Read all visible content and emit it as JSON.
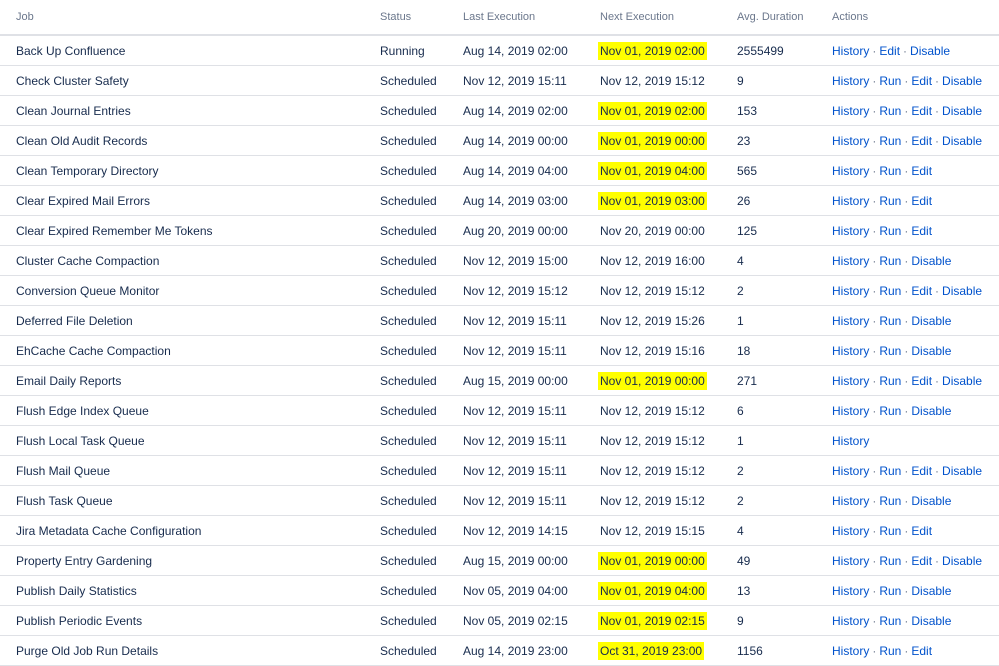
{
  "headers": {
    "job": "Job",
    "status": "Status",
    "last": "Last Execution",
    "next": "Next Execution",
    "avg": "Avg. Duration",
    "actions": "Actions"
  },
  "highlight_color": "#ffff00",
  "link_color": "#0052cc",
  "rows": [
    {
      "job": "Back Up Confluence",
      "status": "Running",
      "last": "Aug 14, 2019 02:00",
      "next": "Nov 01, 2019 02:00",
      "highlight": true,
      "avg": "2555499",
      "actions": [
        "History",
        "Edit",
        "Disable"
      ]
    },
    {
      "job": "Check Cluster Safety",
      "status": "Scheduled",
      "last": "Nov 12, 2019 15:11",
      "next": "Nov 12, 2019 15:12",
      "highlight": false,
      "avg": "9",
      "actions": [
        "History",
        "Run",
        "Edit",
        "Disable"
      ]
    },
    {
      "job": "Clean Journal Entries",
      "status": "Scheduled",
      "last": "Aug 14, 2019 02:00",
      "next": "Nov 01, 2019 02:00",
      "highlight": true,
      "avg": "153",
      "actions": [
        "History",
        "Run",
        "Edit",
        "Disable"
      ]
    },
    {
      "job": "Clean Old Audit Records",
      "status": "Scheduled",
      "last": "Aug 14, 2019 00:00",
      "next": "Nov 01, 2019 00:00",
      "highlight": true,
      "avg": "23",
      "actions": [
        "History",
        "Run",
        "Edit",
        "Disable"
      ]
    },
    {
      "job": "Clean Temporary Directory",
      "status": "Scheduled",
      "last": "Aug 14, 2019 04:00",
      "next": "Nov 01, 2019 04:00",
      "highlight": true,
      "avg": "565",
      "actions": [
        "History",
        "Run",
        "Edit"
      ]
    },
    {
      "job": "Clear Expired Mail Errors",
      "status": "Scheduled",
      "last": "Aug 14, 2019 03:00",
      "next": "Nov 01, 2019 03:00",
      "highlight": true,
      "avg": "26",
      "actions": [
        "History",
        "Run",
        "Edit"
      ]
    },
    {
      "job": "Clear Expired Remember Me Tokens",
      "status": "Scheduled",
      "last": "Aug 20, 2019 00:00",
      "next": "Nov 20, 2019 00:00",
      "highlight": false,
      "avg": "125",
      "actions": [
        "History",
        "Run",
        "Edit"
      ]
    },
    {
      "job": "Cluster Cache Compaction",
      "status": "Scheduled",
      "last": "Nov 12, 2019 15:00",
      "next": "Nov 12, 2019 16:00",
      "highlight": false,
      "avg": "4",
      "actions": [
        "History",
        "Run",
        "Disable"
      ]
    },
    {
      "job": "Conversion Queue Monitor",
      "status": "Scheduled",
      "last": "Nov 12, 2019 15:12",
      "next": "Nov 12, 2019 15:12",
      "highlight": false,
      "avg": "2",
      "actions": [
        "History",
        "Run",
        "Edit",
        "Disable"
      ]
    },
    {
      "job": "Deferred File Deletion",
      "status": "Scheduled",
      "last": "Nov 12, 2019 15:11",
      "next": "Nov 12, 2019 15:26",
      "highlight": false,
      "avg": "1",
      "actions": [
        "History",
        "Run",
        "Disable"
      ]
    },
    {
      "job": "EhCache Cache Compaction",
      "status": "Scheduled",
      "last": "Nov 12, 2019 15:11",
      "next": "Nov 12, 2019 15:16",
      "highlight": false,
      "avg": "18",
      "actions": [
        "History",
        "Run",
        "Disable"
      ]
    },
    {
      "job": "Email Daily Reports",
      "status": "Scheduled",
      "last": "Aug 15, 2019 00:00",
      "next": "Nov 01, 2019 00:00",
      "highlight": true,
      "avg": "271",
      "actions": [
        "History",
        "Run",
        "Edit",
        "Disable"
      ]
    },
    {
      "job": "Flush Edge Index Queue",
      "status": "Scheduled",
      "last": "Nov 12, 2019 15:11",
      "next": "Nov 12, 2019 15:12",
      "highlight": false,
      "avg": "6",
      "actions": [
        "History",
        "Run",
        "Disable"
      ]
    },
    {
      "job": "Flush Local Task Queue",
      "status": "Scheduled",
      "last": "Nov 12, 2019 15:11",
      "next": "Nov 12, 2019 15:12",
      "highlight": false,
      "avg": "1",
      "actions": [
        "History"
      ]
    },
    {
      "job": "Flush Mail Queue",
      "status": "Scheduled",
      "last": "Nov 12, 2019 15:11",
      "next": "Nov 12, 2019 15:12",
      "highlight": false,
      "avg": "2",
      "actions": [
        "History",
        "Run",
        "Edit",
        "Disable"
      ]
    },
    {
      "job": "Flush Task Queue",
      "status": "Scheduled",
      "last": "Nov 12, 2019 15:11",
      "next": "Nov 12, 2019 15:12",
      "highlight": false,
      "avg": "2",
      "actions": [
        "History",
        "Run",
        "Disable"
      ]
    },
    {
      "job": "Jira Metadata Cache Configuration",
      "status": "Scheduled",
      "last": "Nov 12, 2019 14:15",
      "next": "Nov 12, 2019 15:15",
      "highlight": false,
      "avg": "4",
      "actions": [
        "History",
        "Run",
        "Edit"
      ]
    },
    {
      "job": "Property Entry Gardening",
      "status": "Scheduled",
      "last": "Aug 15, 2019 00:00",
      "next": "Nov 01, 2019 00:00",
      "highlight": true,
      "avg": "49",
      "actions": [
        "History",
        "Run",
        "Edit",
        "Disable"
      ]
    },
    {
      "job": "Publish Daily Statistics",
      "status": "Scheduled",
      "last": "Nov 05, 2019 04:00",
      "next": "Nov 01, 2019 04:00",
      "highlight": true,
      "avg": "13",
      "actions": [
        "History",
        "Run",
        "Disable"
      ]
    },
    {
      "job": "Publish Periodic Events",
      "status": "Scheduled",
      "last": "Nov 05, 2019 02:15",
      "next": "Nov 01, 2019 02:15",
      "highlight": true,
      "avg": "9",
      "actions": [
        "History",
        "Run",
        "Disable"
      ]
    },
    {
      "job": "Purge Old Job Run Details",
      "status": "Scheduled",
      "last": "Aug 14, 2019 23:00",
      "next": "Oct 31, 2019 23:00",
      "highlight": true,
      "avg": "1156",
      "actions": [
        "History",
        "Run",
        "Edit"
      ]
    }
  ]
}
